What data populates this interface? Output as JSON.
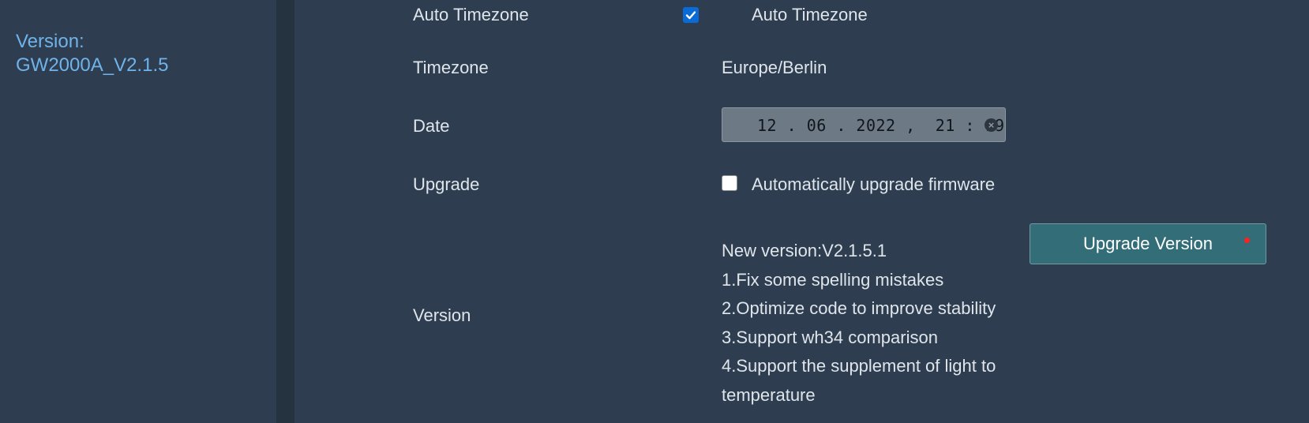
{
  "sidebar": {
    "version_line1": "Version:",
    "version_line2": "GW2000A_V2.1.5"
  },
  "settings": {
    "auto_timezone": {
      "label": "Auto Timezone",
      "checkbox_label": "Auto Timezone",
      "checked": true
    },
    "timezone": {
      "label": "Timezone",
      "value": "Europe/Berlin"
    },
    "date": {
      "label": "Date",
      "value": "12 . 06 . 2022 ,  21 : 19"
    },
    "upgrade": {
      "label": "Upgrade",
      "checkbox_label": "Automatically upgrade firmware",
      "checked": false
    },
    "version": {
      "label": "Version",
      "notes": [
        "New version:V2.1.5.1",
        "1.Fix some spelling mistakes",
        "2.Optimize code to improve stability",
        "3.Support wh34 comparison",
        "4.Support the supplement of light to",
        "temperature"
      ],
      "button_label": "Upgrade Version"
    }
  },
  "colors": {
    "background": "#2e3e50",
    "divider": "#25323f",
    "sidebar_text": "#6fb3ea",
    "button": "#336d78",
    "checkbox_accent": "#0b6bd6",
    "notification_dot": "#ff2020"
  },
  "icons": {
    "checkmark": "check-icon",
    "clear": "close-circle-icon",
    "notification": "notification-dot"
  }
}
